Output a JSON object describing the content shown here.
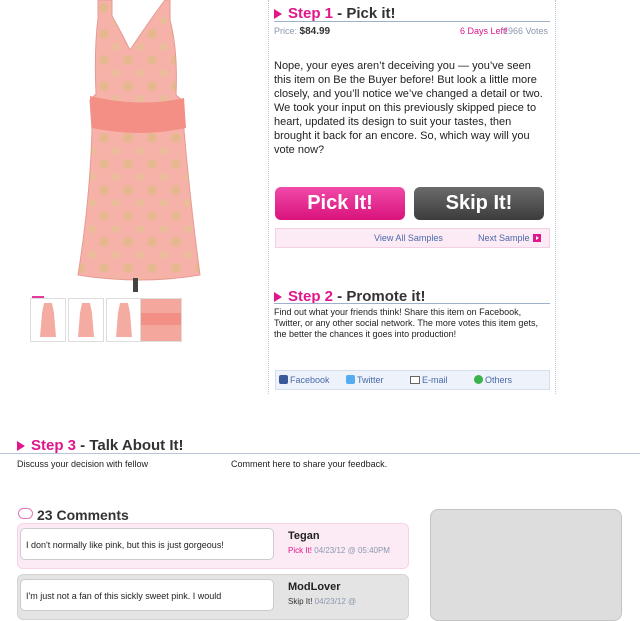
{
  "colors": {
    "accent": "#e1168b",
    "link": "#4a68a8",
    "skip": "#4a4a4a",
    "comment_pink": "#fcebf5",
    "comment_gray": "#e4e4e4"
  },
  "step1": {
    "num": "Step 1",
    "title": " - Pick it!"
  },
  "price": {
    "label": "Price:",
    "value": "$84.99",
    "days_left": "6 Days Left!",
    "votes": "- 1966 Votes"
  },
  "description": "Nope, your eyes aren’t deceiving you — you’ve seen this item on Be the Buyer before! But look a little more closely, and you’ll notice we’ve changed a detail or two. We took your input on this previously skipped piece to heart, updated its design to suit your tastes, then brought it back for an encore. So, which way will you vote now?",
  "buttons": {
    "pick": "Pick It!",
    "skip": "Skip It!"
  },
  "samples": {
    "view_all": "View All Samples",
    "next": "Next Sample"
  },
  "step2": {
    "num": "Step 2",
    "title": " - Promote it!"
  },
  "promote_text": "Find out what your friends think! Share this item on Facebook, Twitter, or any other social network. The more votes this item gets, the better the chances it goes into production!",
  "social": {
    "facebook": "Facebook",
    "twitter": "Twitter",
    "email": "E-mail",
    "others": "Others"
  },
  "step3": {
    "num": "Step 3",
    "title": " - Talk About It!",
    "text": "Discuss your decision with fellow",
    "feedback": "Comment here to share your feedback."
  },
  "comments": {
    "heading": "23 Comments",
    "items": [
      {
        "body": "I don't normally like pink, but this is just gorgeous!",
        "author": "Tegan",
        "vote": "Pick It!",
        "date": " 04/23/12 @ 05:40PM"
      },
      {
        "body": "I'm just not a fan of this sickly sweet pink. I would",
        "author": "ModLover",
        "vote": "Skip It!",
        "date": " 04/23/12 @"
      }
    ]
  }
}
